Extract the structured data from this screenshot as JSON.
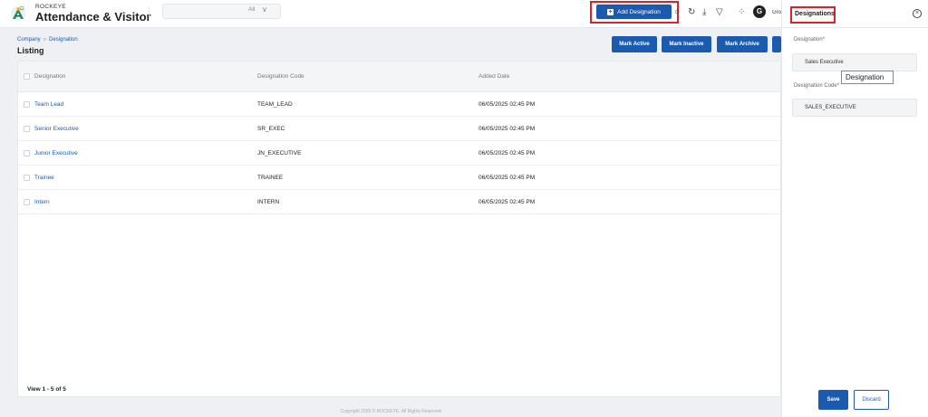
{
  "header": {
    "brand_small": "ROCKEYE",
    "brand_title": "Attendance & Visitor",
    "search_filter": "All",
    "add_button_label": "Add Designation",
    "avatar_initial": "G",
    "avatar_text": "Gro"
  },
  "breadcrumb": {
    "parent": "Company",
    "separator": "»",
    "current": "Designation"
  },
  "page_title": "Listing",
  "actions": [
    "Mark Active",
    "Mark Inactive",
    "Mark Archive"
  ],
  "table": {
    "columns": [
      "Designation",
      "Designation Code",
      "Added Date"
    ],
    "rows": [
      {
        "designation": "Team Lead",
        "code": "TEAM_LEAD",
        "added": "06/05/2025 02:45 PM"
      },
      {
        "designation": "Senior Executive",
        "code": "SR_EXEC",
        "added": "06/05/2025 02:45 PM"
      },
      {
        "designation": "Junior Executive",
        "code": "JN_EXECUTIVE",
        "added": "06/05/2025 02:45 PM"
      },
      {
        "designation": "Trainee",
        "code": "TRAINEE",
        "added": "06/05/2025 02:45 PM"
      },
      {
        "designation": "Intern",
        "code": "INTERN",
        "added": "06/05/2025 02:45 PM"
      }
    ]
  },
  "view_count": "View 1 - 5 of 5",
  "copyright": "Copyright 2025 © ROCKEYE. All Rights Reserved",
  "drawer": {
    "title": "Designations",
    "designation_label": "Designation*",
    "designation_value": "Sales Executive",
    "code_label": "Designation Code*",
    "code_value": "SALES_EXECUTIVE",
    "tooltip": "Designation",
    "save_label": "Save",
    "discard_label": "Discard"
  },
  "colors": {
    "primary": "#1a5bb0",
    "highlight": "#d9232d",
    "logo": "#2e8b57"
  }
}
